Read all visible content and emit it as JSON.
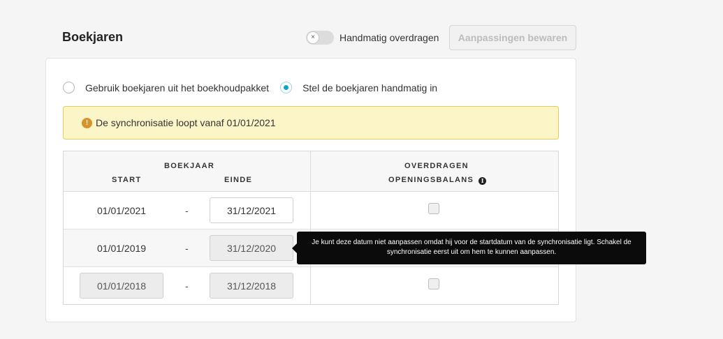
{
  "header": {
    "title": "Boekjaren",
    "toggle_label": "Handmatig overdragen",
    "toggle_icon": "×",
    "save_label": "Aanpassingen bewaren"
  },
  "options": [
    {
      "label": "Gebruik boekjaren uit het boekhoudpakket",
      "selected": false
    },
    {
      "label": "Stel de boekjaren handmatig in",
      "selected": true
    }
  ],
  "alert": {
    "icon": "!",
    "text": "De synchronisatie loopt vanaf 01/01/2021"
  },
  "table": {
    "group_header": "BOEKJAAR",
    "col_start": "START",
    "col_end": "EINDE",
    "col_transfer_line1": "OVERDRAGEN",
    "col_transfer_line2": "OPENINGSBALANS",
    "info_icon": "i",
    "separator": "-",
    "rows": [
      {
        "start": "01/01/2021",
        "end": "31/12/2021"
      },
      {
        "start": "01/01/2019",
        "end": "31/12/2020"
      },
      {
        "start": "01/01/2018",
        "end": "31/12/2018"
      }
    ]
  },
  "tooltip": {
    "text": "Je kunt deze datum niet aanpassen omdat hij voor de startdatum van de synchronisatie ligt. Schakel de synchronisatie eerst uit om hem te kunnen aanpassen."
  },
  "colors": {
    "accent": "#0ea5c9",
    "alert_bg": "#fcf5c7",
    "alert_border": "#e1cd55",
    "alert_icon": "#d9922a"
  }
}
